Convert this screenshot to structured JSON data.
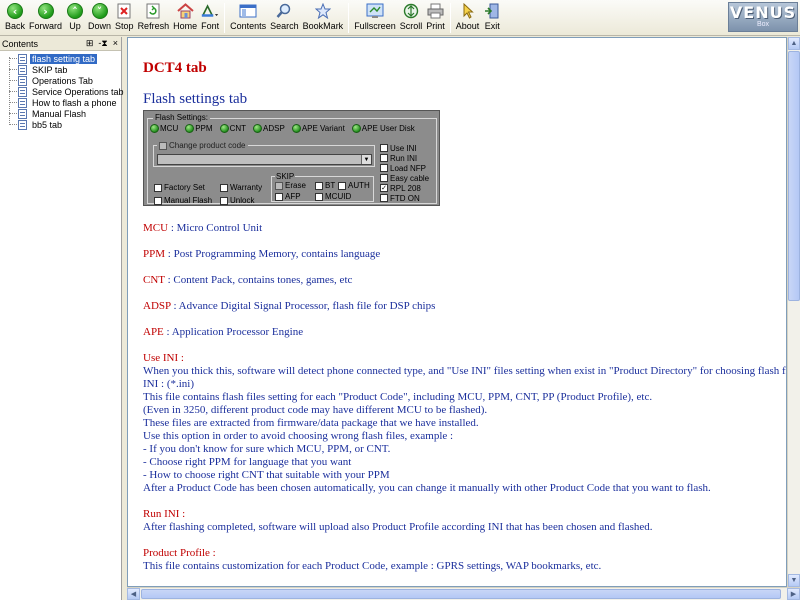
{
  "toolbar": {
    "buttons": [
      {
        "label": "Back"
      },
      {
        "label": "Forward"
      },
      {
        "label": "Up"
      },
      {
        "label": "Down"
      },
      {
        "label": "Stop"
      },
      {
        "label": "Refresh"
      },
      {
        "label": "Home"
      },
      {
        "label": "Font"
      },
      {
        "label": "Contents"
      },
      {
        "label": "Search"
      },
      {
        "label": "BookMark"
      },
      {
        "label": "Fullscreen"
      },
      {
        "label": "Scroll"
      },
      {
        "label": "Print"
      },
      {
        "label": "About"
      },
      {
        "label": "Exit"
      }
    ],
    "brand": "VENUS",
    "brand_sub": "Box"
  },
  "left_pane": {
    "title": "Contents",
    "controls": [
      "⊞",
      "-⧗",
      "×"
    ],
    "items": [
      {
        "label": "flash setting tab",
        "selected": true
      },
      {
        "label": "SKIP tab"
      },
      {
        "label": "Operations Tab"
      },
      {
        "label": "Service Operations tab"
      },
      {
        "label": "How to flash  a phone"
      },
      {
        "label": "Manual Flash"
      },
      {
        "label": "bb5 tab"
      }
    ]
  },
  "content": {
    "heading": "DCT4 tab",
    "subheading": "Flash settings tab",
    "panel": {
      "legend": "Flash Settings:",
      "options": [
        "MCU",
        "PPM",
        "CNT",
        "ADSP",
        "APE Variant",
        "APE User Disk"
      ],
      "change_product_code": "Change product code",
      "factory_set": "Factory Set",
      "warranty": "Warranty",
      "manual_flash": "Manual Flash",
      "unlock": "Unlock",
      "skip_legend": "SKIP",
      "erase": "Erase",
      "bt": "BT",
      "auth": "AUTH",
      "afp": "AFP",
      "mcuid": "MCUID",
      "right_options": [
        {
          "label": "Use INI",
          "checked": false
        },
        {
          "label": "Run INI",
          "checked": false
        },
        {
          "label": "Load NFP",
          "checked": false
        },
        {
          "label": "Easy cable",
          "checked": false
        },
        {
          "label": "RPL 208",
          "checked": true
        },
        {
          "label": "FTD ON",
          "checked": false
        }
      ]
    },
    "definitions": [
      {
        "term": "MCU",
        "desc": " : Micro Control Unit"
      },
      {
        "term": "PPM",
        "desc": " : Post Programming Memory, contains language"
      },
      {
        "term": "CNT",
        "desc": " : Content Pack, contains tones, games, etc"
      },
      {
        "term": "ADSP",
        "desc": " : Advance Digital Signal Processor, flash file for DSP chips"
      },
      {
        "term": "APE",
        "desc": " : Application Processor Engine"
      }
    ],
    "use_ini": {
      "title": "Use INI :",
      "lines": [
        "When you thick this, software will detect phone connected type, and \"Use INI\" files setting when exist in \"Product Directory\" for choosing flash files.",
        "INI : (*.ini)",
        "This file contains flash files setting for each \"Product Code\", including MCU, PPM, CNT,  PP (Product Profile), etc.",
        "(Even in 3250, different product code may have different MCU to be flashed).",
        "These files are extracted from firmware/data package that we have installed.",
        "Use this option in order to avoid choosing wrong flash files, example :",
        "- If you don't know for sure which MCU, PPM, or CNT.",
        "- Choose right PPM for language that you want",
        "- How to choose right CNT that suitable with your PPM",
        "After a Product Code has been chosen automatically, you can change it manually with other Product Code that you want to flash."
      ]
    },
    "run_ini": {
      "title": "Run INI :",
      "lines": [
        "After flashing completed, software will upload also Product Profile according INI that has been chosen and flashed."
      ]
    },
    "product_profile": {
      "title": "Product Profile :",
      "lines": [
        "This file contains customization for each Product Code, example : GPRS settings, WAP bookmarks, etc."
      ]
    }
  }
}
